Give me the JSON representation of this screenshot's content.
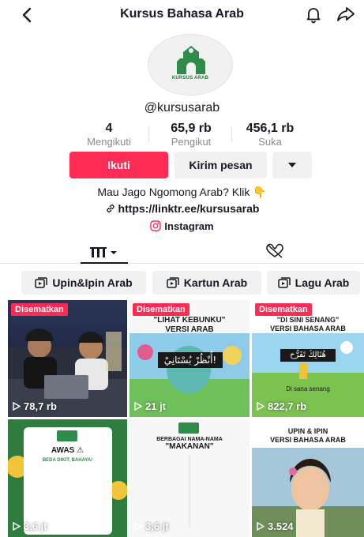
{
  "header": {
    "title": "Kursus Bahasa Arab",
    "back_icon": "chevron-left-icon",
    "bell_icon": "bell-icon",
    "share_icon": "share-arrow-icon"
  },
  "avatar": {
    "logo_text": "KURSUS ARAB"
  },
  "profile": {
    "username": "@kursusarab",
    "stats": [
      {
        "value": "4",
        "label": "Mengikuti"
      },
      {
        "value": "65,9 rb",
        "label": "Pengikut"
      },
      {
        "value": "456,1 rb",
        "label": "Suka"
      }
    ],
    "follow_label": "Ikuti",
    "message_label": "Kirim pesan",
    "bio": "Mau Jago Ngomong Arab? Klik 👇",
    "link": "https://linktr.ee/kursusarab",
    "instagram_label": "Instagram"
  },
  "colors": {
    "accent": "#fe2c55",
    "button_bg": "#f1f1f2",
    "text": "#161823",
    "muted": "#8a8b91"
  },
  "playlists": [
    {
      "label": "Upin&Ipin Arab"
    },
    {
      "label": "Kartun Arab"
    },
    {
      "label": "Lagu Arab"
    }
  ],
  "videos": [
    {
      "pinned": "Disematkan",
      "views": "78,7 rb"
    },
    {
      "pinned": "Disematkan",
      "caption": "\"LIHAT KEBUNKU\"\nVERSI ARAB",
      "arabic": "أُنْظُرْ بُسْتَانِيْ!",
      "views": "21 jt"
    },
    {
      "pinned": "Disematkan",
      "caption": "\"DI SINI SENANG\"\nVERSI BAHASA ARAB",
      "arabic": "هُنَالِكَ تَفَرُّح",
      "subtitle": "Di sana senang",
      "views": "822,7 rb"
    },
    {
      "caption": "AWAS ⚠",
      "subcaption": "BEDA DIKIT, BAHAYA!",
      "views": "3,6 jt"
    },
    {
      "caption": "BERBAGAI NAMA-NAMA",
      "caption2": "\"MAKANAN\"",
      "views": "3,6 jt"
    },
    {
      "caption": "UPIN & IPIN\nVERSI BAHASA ARAB",
      "views": "3.524"
    }
  ]
}
